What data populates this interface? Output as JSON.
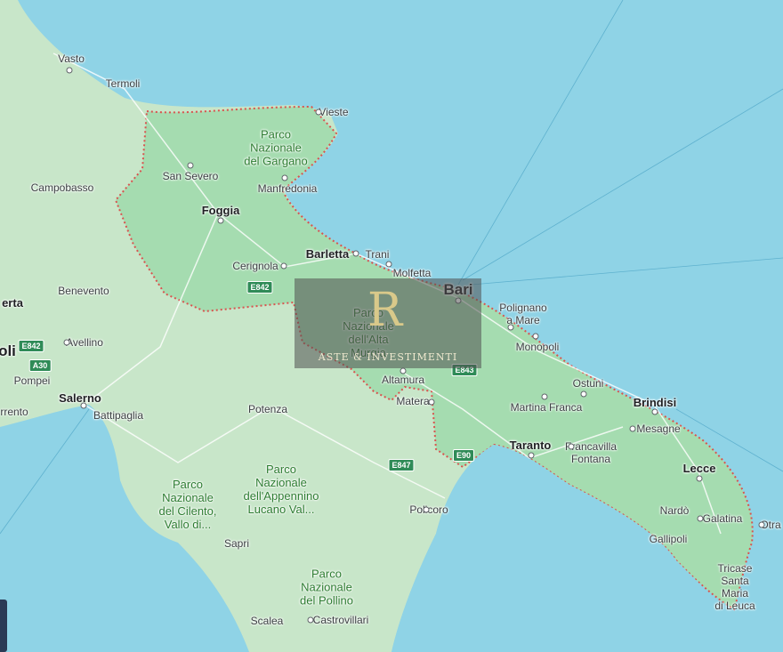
{
  "map": {
    "cities": [
      {
        "id": "vasto",
        "name": "Vasto",
        "cls": ""
      },
      {
        "id": "termoli",
        "name": "Termoli",
        "cls": ""
      },
      {
        "id": "vieste",
        "name": "Vieste",
        "cls": ""
      },
      {
        "id": "san-severo",
        "name": "San Severo",
        "cls": ""
      },
      {
        "id": "campobasso",
        "name": "Campobasso",
        "cls": ""
      },
      {
        "id": "manfredonia",
        "name": "Manfredonia",
        "cls": ""
      },
      {
        "id": "foggia",
        "name": "Foggia",
        "cls": "major"
      },
      {
        "id": "barletta",
        "name": "Barletta",
        "cls": "major"
      },
      {
        "id": "trani",
        "name": "Trani",
        "cls": ""
      },
      {
        "id": "cerignola",
        "name": "Cerignola",
        "cls": ""
      },
      {
        "id": "molfetta",
        "name": "Molfetta",
        "cls": ""
      },
      {
        "id": "bari",
        "name": "Bari",
        "cls": "big"
      },
      {
        "id": "benevento",
        "name": "Benevento",
        "cls": ""
      },
      {
        "id": "erta",
        "name": "erta",
        "cls": "major"
      },
      {
        "id": "polignano",
        "name": "Polignano\na Mare",
        "cls": ""
      },
      {
        "id": "avellino",
        "name": "Avellino",
        "cls": ""
      },
      {
        "id": "oli",
        "name": "oli",
        "cls": "big"
      },
      {
        "id": "monopoli",
        "name": "Monopoli",
        "cls": ""
      },
      {
        "id": "pompei",
        "name": "Pompei",
        "cls": ""
      },
      {
        "id": "altamura",
        "name": "Altamura",
        "cls": ""
      },
      {
        "id": "ostuni",
        "name": "Ostuni",
        "cls": ""
      },
      {
        "id": "salerno",
        "name": "Salerno",
        "cls": "major"
      },
      {
        "id": "brindisi",
        "name": "Brindisi",
        "cls": "major"
      },
      {
        "id": "matera",
        "name": "Matera",
        "cls": ""
      },
      {
        "id": "rrento",
        "name": "rrento",
        "cls": ""
      },
      {
        "id": "martina",
        "name": "Martina Franca",
        "cls": ""
      },
      {
        "id": "battipaglia",
        "name": "Battipaglia",
        "cls": ""
      },
      {
        "id": "potenza",
        "name": "Potenza",
        "cls": ""
      },
      {
        "id": "mesagne",
        "name": "Mesagne",
        "cls": ""
      },
      {
        "id": "taranto",
        "name": "Taranto",
        "cls": "major"
      },
      {
        "id": "francavilla",
        "name": "Francavilla\nFontana",
        "cls": ""
      },
      {
        "id": "lecce",
        "name": "Lecce",
        "cls": "major"
      },
      {
        "id": "policoro",
        "name": "Policoro",
        "cls": ""
      },
      {
        "id": "nardo",
        "name": "Nardò",
        "cls": ""
      },
      {
        "id": "galatina",
        "name": "Galatina",
        "cls": ""
      },
      {
        "id": "otra",
        "name": "Otra",
        "cls": ""
      },
      {
        "id": "sapri",
        "name": "Sapri",
        "cls": ""
      },
      {
        "id": "gallipoli",
        "name": "Gallipoli",
        "cls": ""
      },
      {
        "id": "tricase",
        "name": "Tricase",
        "cls": ""
      },
      {
        "id": "santa-maria",
        "name": "Santa Maria\ndi Leuca",
        "cls": ""
      },
      {
        "id": "scalea",
        "name": "Scalea",
        "cls": ""
      },
      {
        "id": "castrovillari",
        "name": "Castrovillari",
        "cls": ""
      }
    ],
    "parks": [
      {
        "id": "gargano",
        "name": "Parco\nNazionale\ndel Gargano"
      },
      {
        "id": "alta-murgia",
        "name": "Parco\nNazionale\ndell'Alta\nMurgia"
      },
      {
        "id": "appennino",
        "name": "Parco\nNazionale\ndell'Appennino\nLucano Val..."
      },
      {
        "id": "cilento",
        "name": "Parco\nNazionale\ndel Cilento,\nVallo di..."
      },
      {
        "id": "pollino",
        "name": "Parco\nNazionale\ndel Pollino"
      }
    ],
    "roads": [
      "E842",
      "E842",
      "A30",
      "E843",
      "E90",
      "E847"
    ],
    "colors": {
      "sea": "#8fd3e6",
      "land": "#c8e6c9",
      "region": "#a5dcb0",
      "border": "#d9534f"
    }
  },
  "watermark": {
    "logo": "R",
    "text": "ASTE & INVESTIMENTI"
  }
}
